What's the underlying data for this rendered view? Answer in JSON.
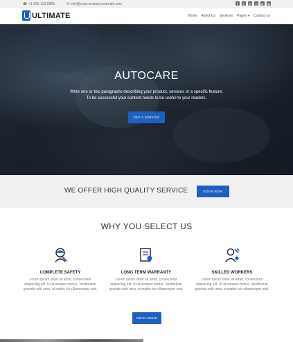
{
  "topbar": {
    "phone": "+1 555 123 8989",
    "email": "info@yourcompany.example.com",
    "socials": [
      {
        "icon": "facebook-icon",
        "glyph": "f"
      },
      {
        "icon": "twitter-icon",
        "glyph": "t"
      },
      {
        "icon": "linkedin-icon",
        "glyph": "in"
      },
      {
        "icon": "instagram-icon",
        "glyph": "◎"
      },
      {
        "icon": "youtube-icon",
        "glyph": "▶"
      },
      {
        "icon": "github-icon",
        "glyph": "◉"
      }
    ]
  },
  "brand": {
    "name": "ULTIMATE",
    "accent": "#1f5fbf"
  },
  "nav": {
    "items": [
      "Home",
      "About Us",
      "Services",
      "Pages ▾",
      "Contact us"
    ],
    "active": "Home"
  },
  "hero": {
    "title": "AUTOCARE",
    "line1": "Write one or two paragraphs describing your product, services or a specific feature.",
    "line2": "To be successful your content needs to be useful to your readers.",
    "button": "GET A SERVICE"
  },
  "offer": {
    "text": "WE OFFER HIGH QUALITY SERVICE",
    "button": "BOOK NOW"
  },
  "why": {
    "title": "WHY YOU SELECT US",
    "features": [
      {
        "icon": "mechanic-helmet-icon",
        "title": "COMPLETE SAFETY",
        "text": "Lorem ipsum dolor sit amet, consectetur adipiscing elit. Ut at semper metus. Vestibulum gravida velit urna, ut mattis leo ullamcorper sed."
      },
      {
        "icon": "warranty-certificate-icon",
        "title": "LONG TERM WARRANTY",
        "text": "Lorem ipsum dolor sit amet, consectetur adipiscing elit. Ut at semper metus. Vestibulum gravida velit urna, ut mattis leo ullamcorper sed."
      },
      {
        "icon": "skilled-worker-icon",
        "title": "SKILLED WORKERS",
        "text": "Lorem ipsum dolor sit amet, consectetur adipiscing elit. Ut at semper metus. Vestibulum gravida velit urna, ut mattis leo ullamcorper sed."
      }
    ],
    "button": "READ MORE"
  }
}
